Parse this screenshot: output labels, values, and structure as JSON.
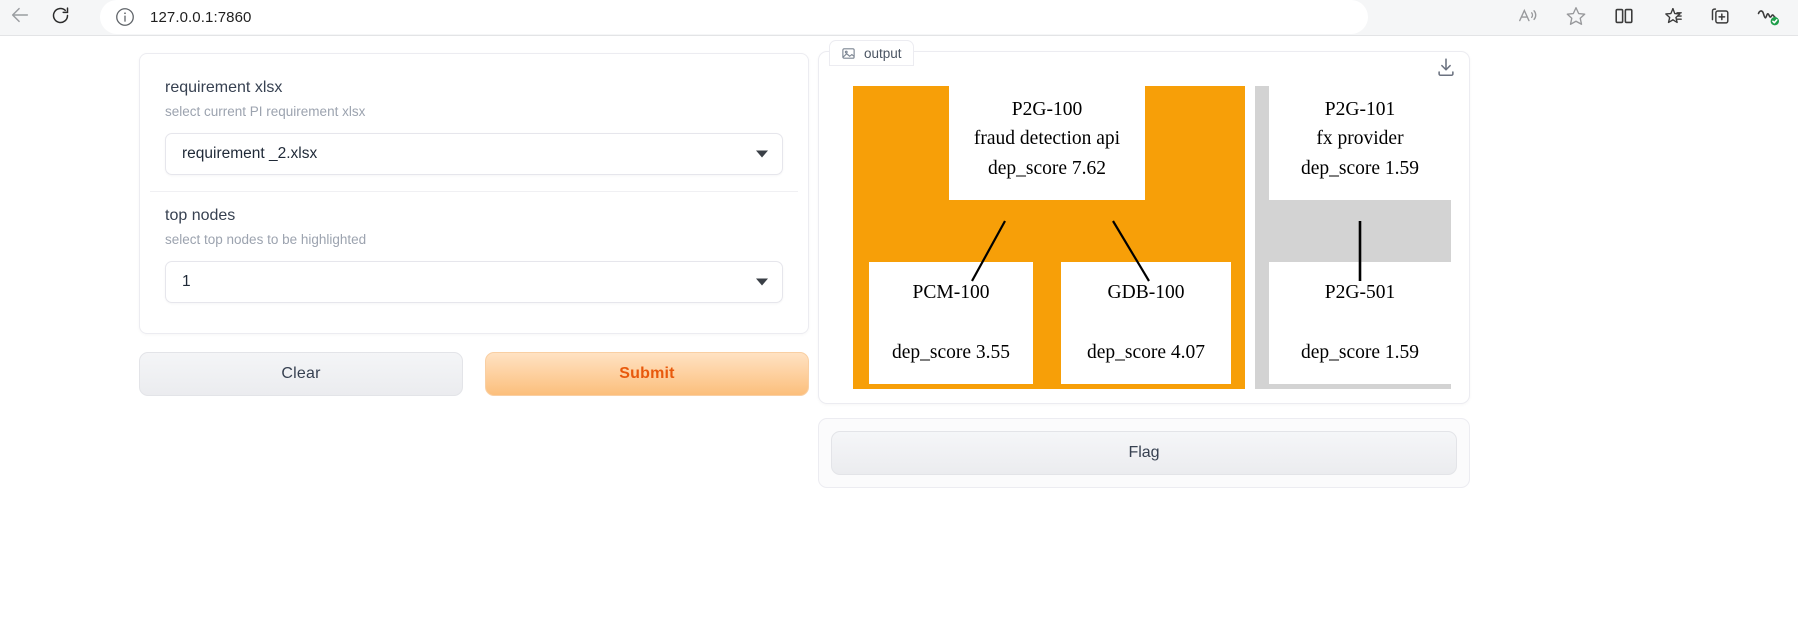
{
  "browser": {
    "back_icon": "back-arrow-icon",
    "reload_icon": "reload-icon",
    "site_info_icon": "site-info-icon",
    "url": "127.0.0.1:7860",
    "toolbar_icons": [
      {
        "name": "read-aloud-icon",
        "label": "Read aloud"
      },
      {
        "name": "favorite-star-icon",
        "label": "Add to favorites"
      },
      {
        "name": "split-screen-icon",
        "label": "Split screen"
      },
      {
        "name": "favorites-list-icon",
        "label": "Favorites"
      },
      {
        "name": "collections-icon",
        "label": "Collections"
      },
      {
        "name": "browser-essentials-icon",
        "label": "Browser essentials"
      }
    ]
  },
  "form": {
    "fields": [
      {
        "label": "requirement xlsx",
        "help": "select current PI requirement xlsx",
        "value": "requirement _2.xlsx"
      },
      {
        "label": "top nodes",
        "help": "select top nodes to be highlighted",
        "value": "1"
      }
    ],
    "clear_label": "Clear",
    "submit_label": "Submit"
  },
  "output": {
    "tab_label": "output",
    "tab_icon": "image-icon",
    "download_icon": "download-icon",
    "flag_label": "Flag",
    "colors": {
      "highlight_cluster": "#f79f08",
      "normal_cluster": "#d3d3d3",
      "node_fill": "#ffffff",
      "edge": "#000000"
    }
  },
  "graph": {
    "clusters": [
      {
        "id": "cluster-highlighted",
        "color": "#f79f08",
        "nodes": [
          {
            "id": "P2G-100",
            "name": "fraud detection api",
            "score_label": "dep_score 7.62",
            "score": 7.62
          },
          {
            "id": "PCM-100",
            "name": "",
            "score_label": "dep_score 3.55",
            "score": 3.55
          },
          {
            "id": "GDB-100",
            "name": "",
            "score_label": "dep_score 4.07",
            "score": 4.07
          }
        ],
        "edges": [
          {
            "from": "P2G-100",
            "to": "PCM-100"
          },
          {
            "from": "P2G-100",
            "to": "GDB-100"
          }
        ]
      },
      {
        "id": "cluster-normal",
        "color": "#d3d3d3",
        "nodes": [
          {
            "id": "P2G-101",
            "name": "fx provider",
            "score_label": "dep_score 1.59",
            "score": 1.59
          },
          {
            "id": "P2G-501",
            "name": "",
            "score_label": "dep_score 1.59",
            "score": 1.59
          }
        ],
        "edges": [
          {
            "from": "P2G-101",
            "to": "P2G-501"
          }
        ]
      }
    ]
  }
}
